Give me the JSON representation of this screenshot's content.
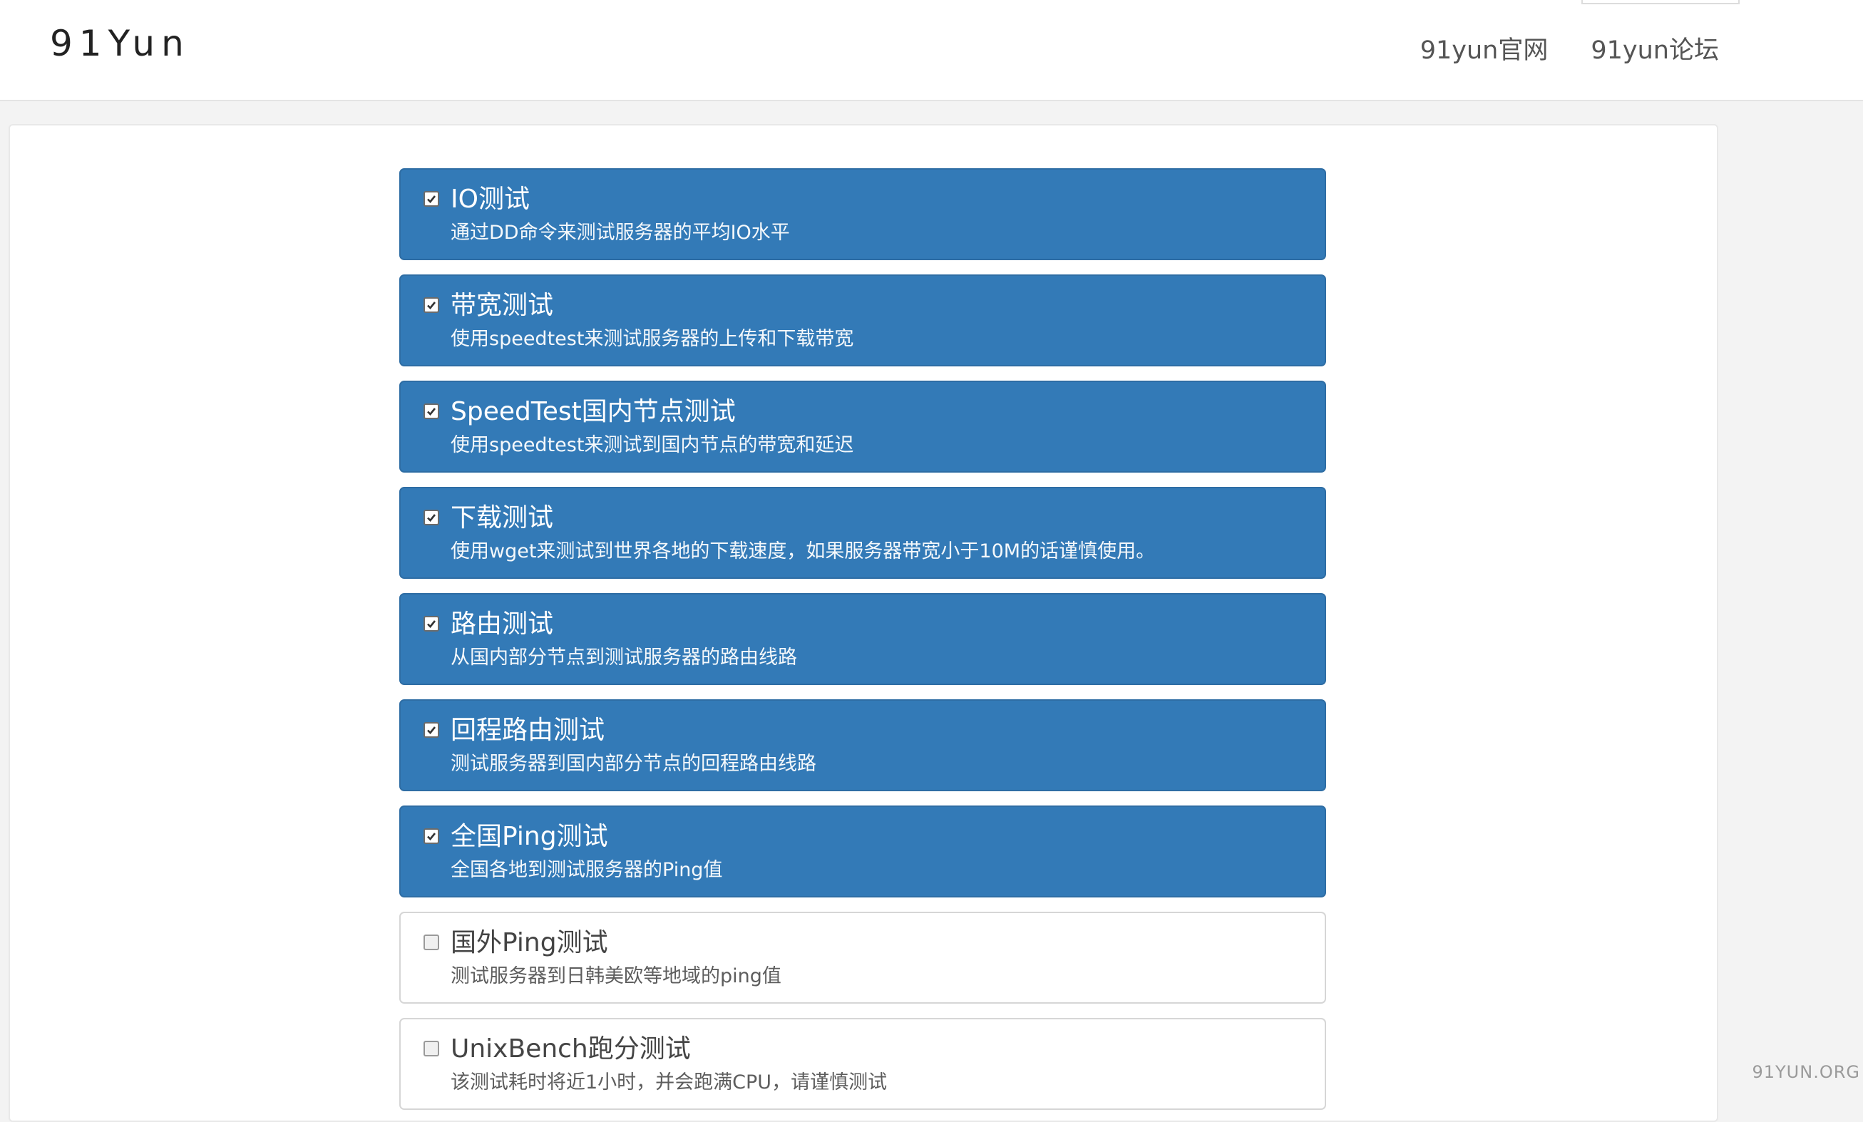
{
  "brand": "91Yun",
  "nav": {
    "links": [
      {
        "label": "91yun官网"
      },
      {
        "label": "91yun论坛"
      }
    ]
  },
  "tests": [
    {
      "title": "IO测试",
      "desc": "通过DD命令来测试服务器的平均IO水平",
      "checked": true
    },
    {
      "title": "带宽测试",
      "desc": "使用speedtest来测试服务器的上传和下载带宽",
      "checked": true
    },
    {
      "title": "SpeedTest国内节点测试",
      "desc": "使用speedtest来测试到国内节点的带宽和延迟",
      "checked": true
    },
    {
      "title": "下载测试",
      "desc": "使用wget来测试到世界各地的下载速度，如果服务器带宽小于10M的话谨慎使用。",
      "checked": true
    },
    {
      "title": "路由测试",
      "desc": "从国内部分节点到测试服务器的路由线路",
      "checked": true
    },
    {
      "title": "回程路由测试",
      "desc": "测试服务器到国内部分节点的回程路由线路",
      "checked": true
    },
    {
      "title": "全国Ping测试",
      "desc": "全国各地到测试服务器的Ping值",
      "checked": true
    },
    {
      "title": "国外Ping测试",
      "desc": "测试服务器到日韩美欧等地域的ping值",
      "checked": false
    },
    {
      "title": "UnixBench跑分测试",
      "desc": "该测试耗时将近1小时，并会跑满CPU，请谨慎测试",
      "checked": false
    }
  ],
  "watermark": "91YUN.ORG",
  "colors": {
    "accent": "#337ab7",
    "accent_border": "#2e6da4"
  }
}
